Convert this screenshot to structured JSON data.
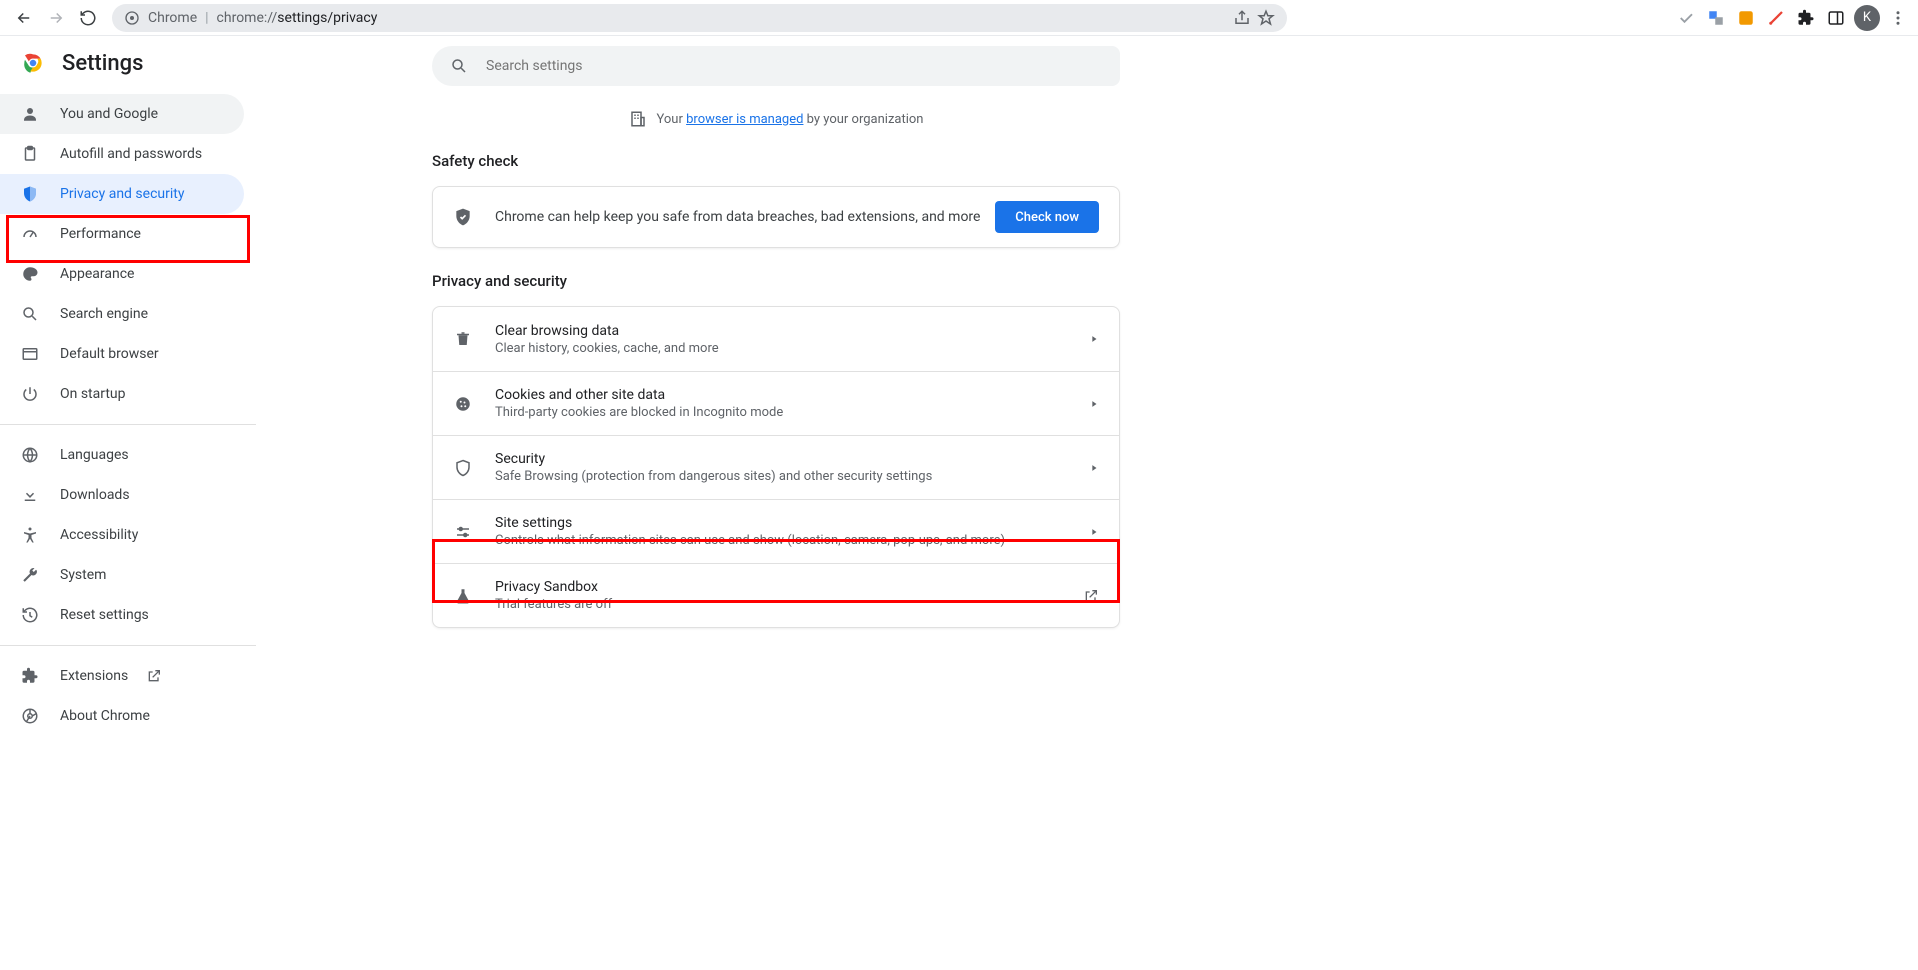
{
  "browser": {
    "chip": "Chrome",
    "url_prefix": "chrome://",
    "url_path": "settings/privacy",
    "avatar_letter": "K"
  },
  "brand_title": "Settings",
  "sidebar": {
    "group1": [
      {
        "label": "You and Google"
      },
      {
        "label": "Autofill and passwords"
      },
      {
        "label": "Privacy and security"
      },
      {
        "label": "Performance"
      },
      {
        "label": "Appearance"
      },
      {
        "label": "Search engine"
      },
      {
        "label": "Default browser"
      },
      {
        "label": "On startup"
      }
    ],
    "group2": [
      {
        "label": "Languages"
      },
      {
        "label": "Downloads"
      },
      {
        "label": "Accessibility"
      },
      {
        "label": "System"
      },
      {
        "label": "Reset settings"
      }
    ],
    "extensions_label": "Extensions",
    "about_label": "About Chrome"
  },
  "search_placeholder": "Search settings",
  "managed_notice": {
    "prefix": "Your ",
    "link": "browser is managed",
    "suffix": " by your organization"
  },
  "sections": {
    "safety_title": "Safety check",
    "safety_text": "Chrome can help keep you safe from data breaches, bad extensions, and more",
    "check_now": "Check now",
    "privacy_title": "Privacy and security",
    "rows": [
      {
        "title": "Clear browsing data",
        "sub": "Clear history, cookies, cache, and more"
      },
      {
        "title": "Cookies and other site data",
        "sub": "Third-party cookies are blocked in Incognito mode"
      },
      {
        "title": "Security",
        "sub": "Safe Browsing (protection from dangerous sites) and other security settings"
      },
      {
        "title": "Site settings",
        "sub": "Controls what information sites can use and show (location, camera, pop-ups, and more)"
      },
      {
        "title": "Privacy Sandbox",
        "sub": "Trial features are off"
      }
    ]
  }
}
